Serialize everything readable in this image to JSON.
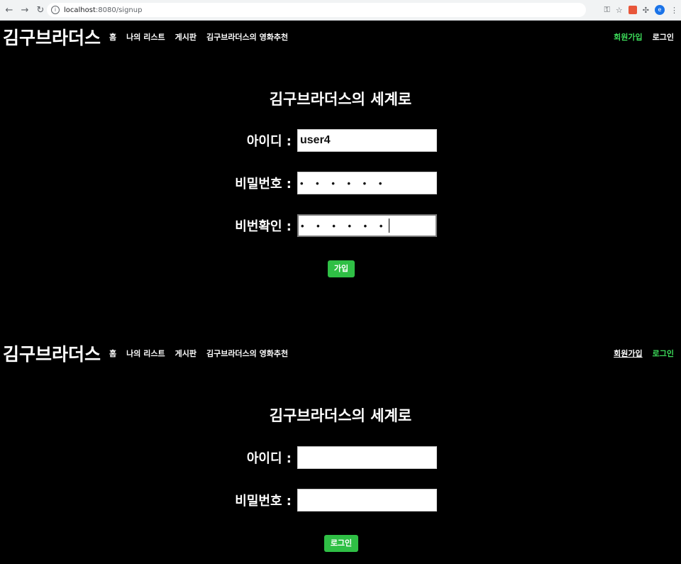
{
  "browser": {
    "url_host": "localhost",
    "url_rest": ":8080/signup",
    "back_icon": "←",
    "forward_icon": "→",
    "reload_icon": "↻",
    "key_icon": "⚿",
    "star_icon": "☆",
    "puzzle_icon": "✣",
    "menu_icon": "⋮",
    "avatar_letter": "e"
  },
  "top": {
    "brand": "김구브라더스",
    "menu": [
      "홈",
      "나의 리스트",
      "게시판",
      "김구브라더스의 영화추천"
    ],
    "signup": "회원가입",
    "login": "로그인",
    "title": "김구브라더스의 세계로",
    "labels": {
      "id": "아이디 :",
      "password": "비밀번호 :",
      "confirm": "비번확인 :"
    },
    "values": {
      "id": "user4",
      "password": "• • • • • •",
      "confirm": "• • • • • •"
    },
    "submit": "가입"
  },
  "bottom": {
    "brand": "김구브라더스",
    "menu": [
      "홈",
      "나의 리스트",
      "게시판",
      "김구브라더스의 영화추천"
    ],
    "signup": "회원가입",
    "login": "로그인",
    "title": "김구브라더스의 세계로",
    "labels": {
      "id": "아이디 :",
      "password": "비밀번호 :"
    },
    "values": {
      "id": "",
      "password": ""
    },
    "submit": "로그인"
  },
  "colors": {
    "accent": "#3ddc5a",
    "button": "#2fbf45",
    "background": "#000000"
  }
}
